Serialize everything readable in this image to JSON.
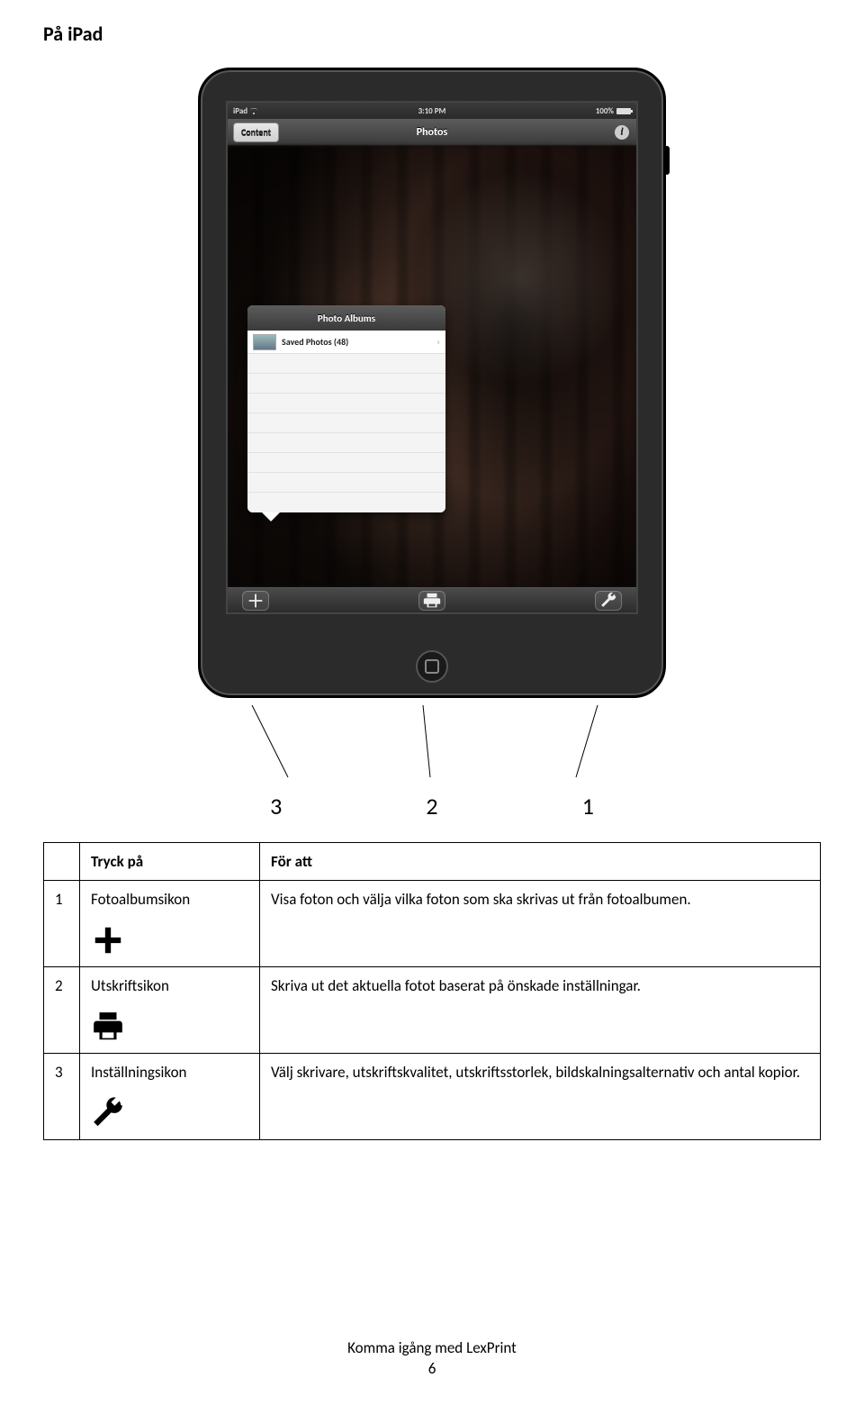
{
  "page_title": "På iPad",
  "device": {
    "status": {
      "left": "iPad",
      "time": "3:10 PM",
      "battery_text": "100%"
    },
    "nav": {
      "back_label": "Content",
      "title": "Photos",
      "info_glyph": "i"
    },
    "popover": {
      "title": "Photo Albums",
      "row_label": "Saved Photos  (48)"
    },
    "toolbar": {
      "add_label": "+",
      "print_label": "print",
      "settings_label": "wrench"
    }
  },
  "callout_numbers": {
    "a": "3",
    "b": "2",
    "c": "1"
  },
  "table": {
    "headers": {
      "col1_blank": "",
      "col2": "Tryck på",
      "col3": "För att"
    },
    "rows": [
      {
        "num": "1",
        "label": "Fotoalbumsikon",
        "desc": "Visa foton och välja vilka foton som ska skrivas ut från fotoalbumen.",
        "icon": "plus"
      },
      {
        "num": "2",
        "label": "Utskriftsikon",
        "desc": "Skriva ut det aktuella fotot baserat på önskade inställningar.",
        "icon": "printer"
      },
      {
        "num": "3",
        "label": "Inställningsikon",
        "desc": "Välj skrivare, utskriftskvalitet, utskriftsstorlek, bildskalningsalternativ och antal kopior.",
        "icon": "wrench"
      }
    ]
  },
  "footer": {
    "text": "Komma igång med LexPrint",
    "page": "6"
  }
}
